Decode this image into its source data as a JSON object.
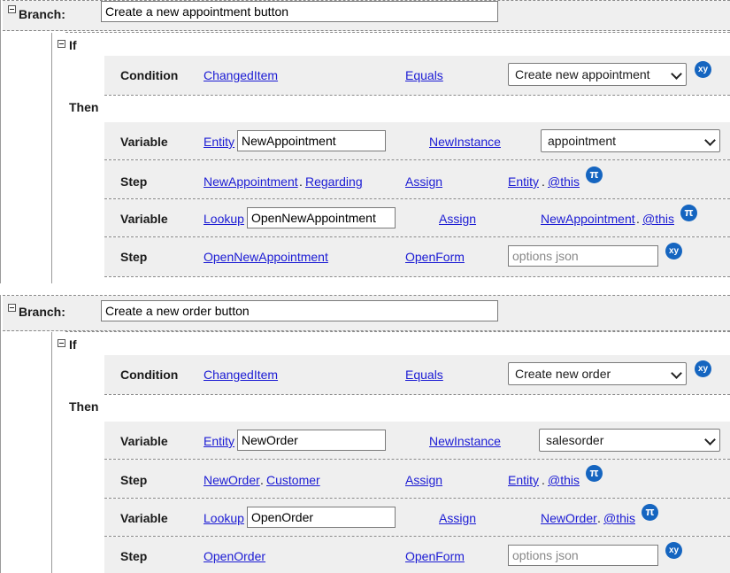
{
  "branches": [
    {
      "label": "Branch:",
      "name": "Create a new appointment button",
      "if_label": "If",
      "then_label": "Then",
      "condition": {
        "label": "Condition",
        "field": "ChangedItem",
        "operator": "Equals",
        "value": "Create new appointment",
        "badge": "xy"
      },
      "rows": [
        {
          "label": "Variable",
          "kind": "Entity",
          "name": "NewAppointment",
          "action": "NewInstance",
          "value": "appointment"
        },
        {
          "label": "Step",
          "target": "NewAppointment",
          "dot": ".",
          "property": "Regarding",
          "action": "Assign",
          "src": "Entity",
          "dot2": ".",
          "src_prop": "@this",
          "badge": "π"
        },
        {
          "label": "Variable",
          "kind": "Lookup",
          "name": "OpenNewAppointment",
          "action": "Assign",
          "src": "NewAppointment",
          "dot": ".",
          "src_prop": "@this",
          "badge": "π"
        },
        {
          "label": "Step",
          "target": "OpenNewAppointment",
          "action": "OpenForm",
          "placeholder": "options json",
          "badge": "xy"
        }
      ]
    },
    {
      "label": "Branch:",
      "name": "Create a new order button",
      "if_label": "If",
      "then_label": "Then",
      "condition": {
        "label": "Condition",
        "field": "ChangedItem",
        "operator": "Equals",
        "value": "Create new order",
        "badge": "xy"
      },
      "rows": [
        {
          "label": "Variable",
          "kind": "Entity",
          "name": "NewOrder",
          "action": "NewInstance",
          "value": "salesorder"
        },
        {
          "label": "Step",
          "target": "NewOrder",
          "dot": ".",
          "property": "Customer",
          "action": "Assign",
          "src": "Entity",
          "dot2": ".",
          "src_prop": "@this",
          "badge": "π"
        },
        {
          "label": "Variable",
          "kind": "Lookup",
          "name": "OpenOrder",
          "action": "Assign",
          "src": "NewOrder",
          "dot": ".",
          "src_prop": "@this",
          "badge": "π"
        },
        {
          "label": "Step",
          "target": "OpenOrder",
          "action": "OpenForm",
          "placeholder": "options json",
          "badge": "xy"
        }
      ]
    }
  ]
}
